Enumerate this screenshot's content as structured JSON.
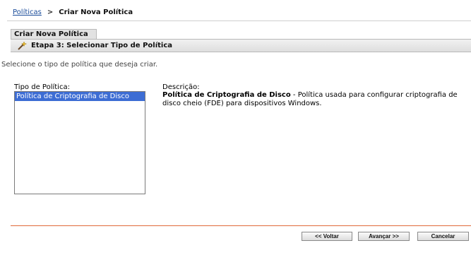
{
  "breadcrumb": {
    "link": "Políticas",
    "separator": ">",
    "current": "Criar Nova Política"
  },
  "tab": {
    "label": "Criar Nova Política"
  },
  "step": {
    "title": "Etapa 3: Selecionar Tipo de Política",
    "icon": "wand-icon"
  },
  "instructions": "Selecione o tipo de política que deseja criar.",
  "policy_type": {
    "label": "Tipo de Política:",
    "options": [
      "Política de Criptografia de Disco"
    ],
    "selected": "Política de Criptografia de Disco"
  },
  "description": {
    "label": "Descrição:",
    "name": "Política de Criptografia de Disco",
    "text": " - Política usada para configurar criptografia de disco cheio (FDE) para dispositivos Windows."
  },
  "buttons": {
    "back": "<< Voltar",
    "next": "Avançar >>",
    "cancel": "Cancelar"
  },
  "colors": {
    "link": "#1a4c9a",
    "selection": "#3d6dd4",
    "divider": "#e06a3a"
  }
}
